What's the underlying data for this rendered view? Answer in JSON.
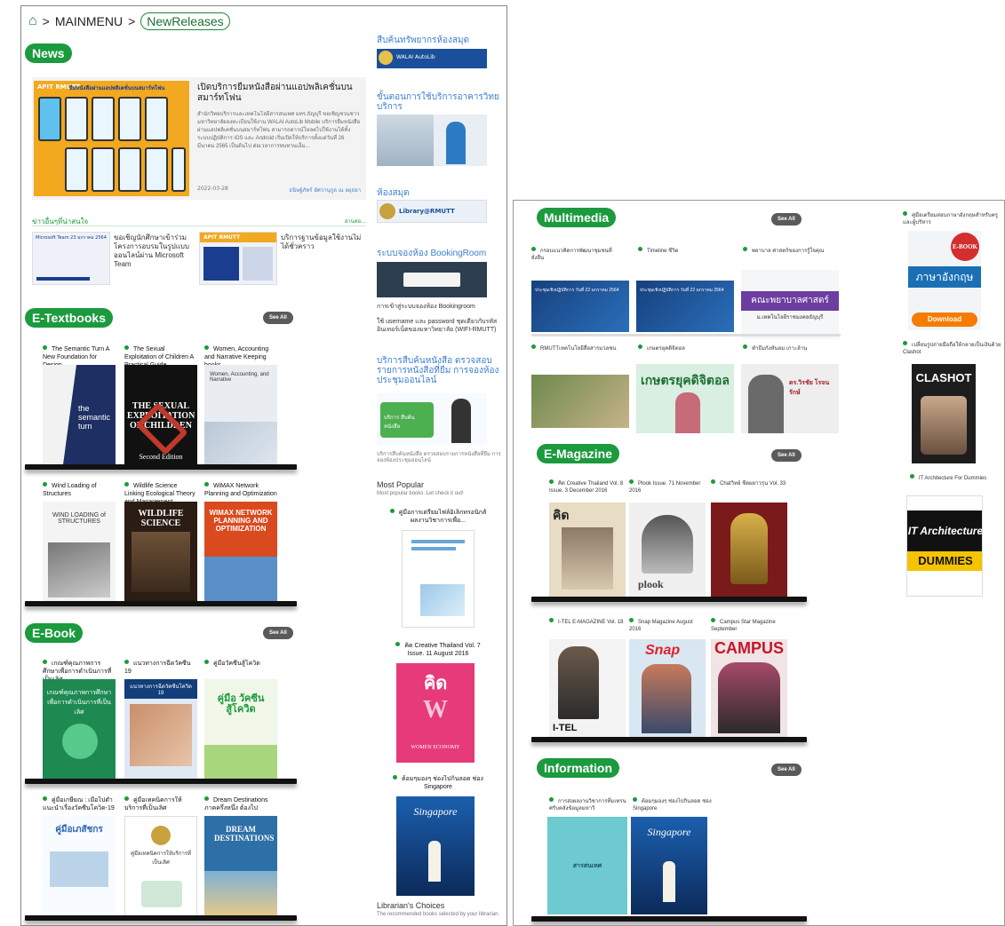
{
  "breadcrumb": {
    "home_icon": "home-icon",
    "sep": ">",
    "main": "MAINMENU",
    "current": "NewReleases"
  },
  "news": {
    "header": "News",
    "feature": {
      "title": "เปิดบริการยืมหนังสือผ่านแอปพลิเคชั่นบนสมาร์ทโฟน",
      "body": "สำนักวิทยบริการและเทคโนโลยีสารสนเทศ มทร.ธัญบุรี ขอเชิญชวนชาวมหาวิทยาลัยลงทะเบียนใช้งาน WALAI AutoLib Mobile บริการยืมหนังสือผ่านแอปพลิเคชั่นบนสมาร์ทโฟน สามารถดาวน์โหลดไปใช้งานได้ทั้งระบบปฏิบัติการ iOS และ Android เริ่มเปิดให้บริการตั้งแต่วันที่ 26 มีนาคม 2565 เป็นต้นไป ต่อเวลาการทบทวนเอ็ม...",
      "date": "2022-03-28",
      "author": "ธนิษฐ์ภัทร์ อัศวานุกูล ณ อยุธยา",
      "banner_text": "ยืมหนังสือผ่านแอปพลิเคชั่นบนสมาร์ทโฟน",
      "banner_logo": "APIT RMUTT"
    },
    "interesting_label": "ข่าวอื่นๆที่น่าสนใจ",
    "more_label": "อ่านต่อ...",
    "items": [
      {
        "title": "ขอเชิญนักศึกษาเข้าร่วมโครงการอบรมในรูปแบบออนไลน์ผ่าน Microsoft Team",
        "thumb": "Microsoft Team 23 มกราคม 2564"
      },
      {
        "title": "บริการฐานข้อมูลใช้งานไม่ได้ชั่วคราว",
        "thumb": "APIT RMUTT"
      }
    ]
  },
  "sidebar": {
    "sections": [
      {
        "title": "สืบค้นทรัพยากรห้องสมุด",
        "img_text": "WALAI AutoLib"
      },
      {
        "title": "ขั้นตอนการใช้บริการอาคารวิทยบริการ",
        "img_text": ""
      },
      {
        "title": "ห้องสมุด",
        "img_text": "Library@RMUTT"
      },
      {
        "title": "ระบบจองห้อง BookingRoom",
        "img_text": "",
        "desc1": "การเข้าสู่ระบบจองห้อง Bookingroom",
        "desc2": "ใช้ username และ password ชุดเดียวกับรหัสอินเทอร์เน็ตของมหาวิทยาลัย (WIFI-RMUTT)"
      },
      {
        "title": "บริการสืบค้นหนังสือ ตรวจสอบรายการหนังสือที่ยืม การจองห้องประชุมออนไลน์",
        "img_text": "บริการ สืบค้นหนังสือ",
        "desc1": "บริการสืบค้นหนังสือ ตรวจสอบรายการหนังสือที่ยืม การจองห้องประชุมออนไลน์"
      }
    ],
    "popular": {
      "title": "Most Popular",
      "subtitle": "Most popular books. Let check it out!",
      "books": [
        {
          "title": "คู่มือการเตรียมไฟล์อิเล็กทรอนิกส์ผลงานวิชาการเพื่อ..."
        },
        {
          "title": "คิด Creative Thailand Vol. 7 Issue. 11 August 2016",
          "cover": "คิด",
          "sub": "WOMEN ECONOMY"
        },
        {
          "title": "ด้อมๆมองๆ ช่องไปกินลอด ช่อง Singapore",
          "cover": "Singapore"
        }
      ]
    },
    "choices": {
      "title": "Librarian's Choices",
      "subtitle": "The recommended books selected by your librarian."
    }
  },
  "etextbooks": {
    "header": "E-Textbooks",
    "see_all": "See All",
    "row1": [
      {
        "title": "The Semantic Turn A New Foundation for Design",
        "cover": "the semantic turn"
      },
      {
        "title": "The Sexual Exploitation of Children A Practical Guide",
        "cover": "THE SEXUAL EXPLOITATION OF CHILDREN",
        "sub": "Second Edition"
      },
      {
        "title": "Women, Accounting and Narrative Keeping books",
        "cover": "Women, Accounting, and Narrative"
      }
    ],
    "row2": [
      {
        "title": "Wind Loading of Structures",
        "cover": "WIND LOADING of STRUCTURES"
      },
      {
        "title": "Wildlife Science Linking Ecological Theory and Management",
        "cover": "WILDLIFE SCIENCE"
      },
      {
        "title": "WiMAX Network Planning and Optimization",
        "cover": "WIMAX NETWORK PLANNING AND OPTIMIZATION"
      }
    ]
  },
  "ebook": {
    "header": "E-Book",
    "see_all": "See All",
    "row1": [
      {
        "title": "เกณฑ์คุณภาพการศึกษาเพื่อการดำเนินการที่เป็นเลิศ",
        "cover": "เกณฑ์คุณภาพการศึกษาเพื่อการดำเนินการที่เป็นเลิศ"
      },
      {
        "title": "แนวทางการฉีดวัคซีน 19",
        "cover": "แนวทางการฉีดวัคซีนโควิด 19"
      },
      {
        "title": "คู่มือวัคซีนสู้โควิด",
        "cover": "คู่มือ วัคซีน สู้โควิด"
      }
    ],
    "row2": [
      {
        "title": "คู่มือเกษียณ : เมื่อไปดำแนะนำเรื่องวัคซีนโควิด-19",
        "cover": "คู่มือเภสัชกร"
      },
      {
        "title": "คู่มือเทคนิคการให้บริการที่เป็นเลิศ",
        "cover": "คู่มือเทคนิคการให้บริการที่เป็นเลิศ"
      },
      {
        "title": "Dream Destinations ภาคครึ่งหนึ่ง ต้องไป",
        "cover": "DREAM DESTINATIONS"
      }
    ]
  },
  "multimedia": {
    "header": "Multimedia",
    "see_all": "See All",
    "row1": [
      {
        "title": "กรอบแนวคิดการพัฒนาชุมชนที่ยั่งยืน",
        "thumb": "ประชุมเชิงปฏิบัติการ วันที่ 22 มกราคม 2564"
      },
      {
        "title": "Timeline ชีวิต",
        "thumb": "ประชุมเชิงปฏิบัติการ วันที่ 22 มกราคม 2564"
      },
      {
        "title": "พยาบาล ศาสตร์ของการรู้ใจคุณ",
        "thumb": "คณะพยาบาลศาสตร์",
        "sub": "ม.เทคโนโลยีราชมงคลธัญบุรี"
      }
    ],
    "row2": [
      {
        "title": "RMUTTเทคโนโลยีสื่อสารมวลชน",
        "thumb": ""
      },
      {
        "title": "เกษตรยุคดิจิตอล",
        "thumb": "เกษตรยุคดิจิตอล"
      },
      {
        "title": "ทำธีมกังหันลม เกาะล้าน",
        "thumb": "ดร.วิรชัย โรจนรักษ์"
      }
    ]
  },
  "emagazine": {
    "header": "E-Magazine",
    "see_all": "See All",
    "row1": [
      {
        "title": "คิด Creative Thailand Vol. 8 Issue. 3 December 2016",
        "cover": "คิด"
      },
      {
        "title": "Plook Issue. 71 November 2016",
        "cover": "plook"
      },
      {
        "title": "Chatวิทย์ ชีดผยาวรุน Vol. 33",
        "cover": ""
      }
    ],
    "row2": [
      {
        "title": "I-TEL E-MAGAZINE Vol. 18",
        "cover": "I-TEL"
      },
      {
        "title": "Snap Magazine August 2016",
        "cover": "Snap"
      },
      {
        "title": "Campus Star Magazine September",
        "cover": "CAMPUS"
      }
    ]
  },
  "information": {
    "header": "Information",
    "see_all": "See All",
    "items": [
      {
        "title": "การส่งผลงานวิชาการที่มเทรนศรับคลังข้อมูลมหาวิ",
        "cover": "สารสนเทศ"
      },
      {
        "title": "ด้อมๆมองๆ ช่องไปกินลอด ช่อง Singapore",
        "cover": "Singapore"
      }
    ]
  },
  "right2": {
    "books": [
      {
        "title": "คู่มือเตรียมสอบภาษาอังกฤษสำหรับครูและผู้บริหาร",
        "cover": "ภาษาอังกฤษ",
        "badge": "E-BOOK",
        "btn": "Download"
      },
      {
        "title": "เปลี่ยนรูปถ่ายมือถือให้กลายเป็นเงินด้วย Clashot",
        "cover": "CLASHOT"
      },
      {
        "title": "IT Architecture For Dummies",
        "cover": "IT Architecture",
        "sub": "DUMMIES"
      }
    ]
  },
  "colors": {
    "accent": "#1b9a3e",
    "link": "#3c7fd1",
    "shelf": "#111111"
  }
}
